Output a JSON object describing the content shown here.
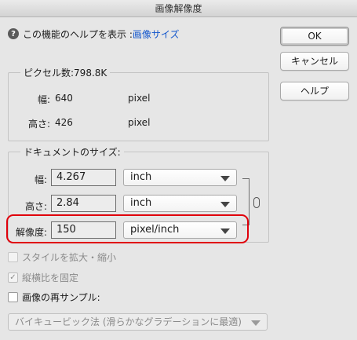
{
  "window": {
    "title": "画像解像度"
  },
  "help": {
    "icon": "question-mark-icon",
    "prefix": "この機能のヘルプを表示 : ",
    "link": "画像サイズ"
  },
  "buttons": {
    "ok": "OK",
    "cancel": "キャンセル",
    "help": "ヘルプ"
  },
  "pixel_dimensions": {
    "legend": "ピクセル数:798.8K",
    "width_label": "幅:",
    "width_value": "640",
    "width_unit": "pixel",
    "height_label": "高さ:",
    "height_value": "426",
    "height_unit": "pixel"
  },
  "document_size": {
    "legend": "ドキュメントのサイズ:",
    "width_label": "幅:",
    "width_value": "4.267",
    "width_unit": "inch",
    "height_label": "高さ:",
    "height_value": "2.84",
    "height_unit": "inch",
    "resolution_label": "解像度:",
    "resolution_value": "150",
    "resolution_unit": "pixel/inch"
  },
  "options": {
    "scale_styles": {
      "label": "スタイルを拡大・縮小",
      "checked": false,
      "enabled": false
    },
    "constrain_proportions": {
      "label": "縦横比を固定",
      "checked": true,
      "enabled": false
    },
    "resample": {
      "label": "画像の再サンプル:",
      "checked": false,
      "enabled": true
    }
  },
  "resample_method": {
    "value": "バイキュービック法 (滑らかなグラデーションに最適)"
  },
  "colors": {
    "highlight": "#e0000b",
    "link": "#1155cc"
  }
}
